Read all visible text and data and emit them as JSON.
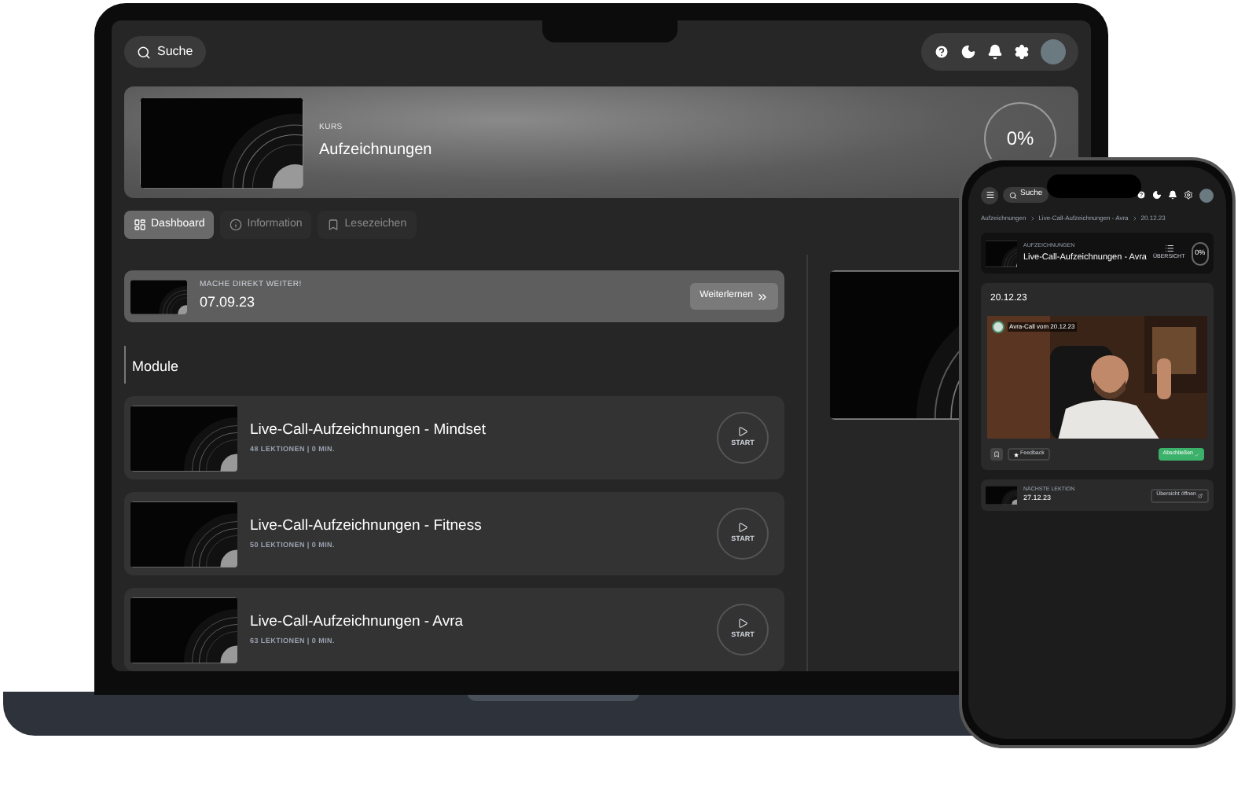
{
  "topbar": {
    "search_label": "Suche"
  },
  "hero": {
    "eyebrow": "KURS",
    "title": "Aufzeichnungen",
    "progress": "0%"
  },
  "tabs": [
    {
      "label": "Dashboard",
      "kind": "dashboard",
      "selected": true
    },
    {
      "label": "Information",
      "kind": "info",
      "selected": false
    },
    {
      "label": "Lesezeichen",
      "kind": "bookmark",
      "selected": false
    }
  ],
  "continue": {
    "eyebrow": "MACHE DIREKT WEITER!",
    "date": "07.09.23",
    "button": "Weiterlernen"
  },
  "modules_heading": "Module",
  "modules": [
    {
      "title": "Live-Call-Aufzeichnungen - Mindset",
      "meta": "48 LEKTIONEN | 0 MIN.",
      "action": "START"
    },
    {
      "title": "Live-Call-Aufzeichnungen - Fitness",
      "meta": "50 LEKTIONEN | 0 MIN.",
      "action": "START"
    },
    {
      "title": "Live-Call-Aufzeichnungen - Avra",
      "meta": "63 LEKTIONEN | 0 MIN.",
      "action": "START"
    }
  ],
  "phone": {
    "search_label": "Suche",
    "breadcrumb": [
      "Aufzeichnungen",
      "Live-Call-Aufzeichnungen - Avra",
      "20.12.23"
    ],
    "header": {
      "eyebrow": "AUFZEICHNUNGEN",
      "title": "Live-Call-Aufzeichnungen - Avra",
      "overview": "ÜBERSICHT",
      "progress": "0%"
    },
    "lesson": {
      "date": "20.12.23",
      "video_title": "Avra-Call vom 20.12.23",
      "feedback": "Feedback",
      "complete": "Abschließen"
    },
    "next": {
      "eyebrow": "NÄCHSTE LEKTION",
      "date": "27.12.23",
      "button": "Übersicht öffnen"
    }
  }
}
